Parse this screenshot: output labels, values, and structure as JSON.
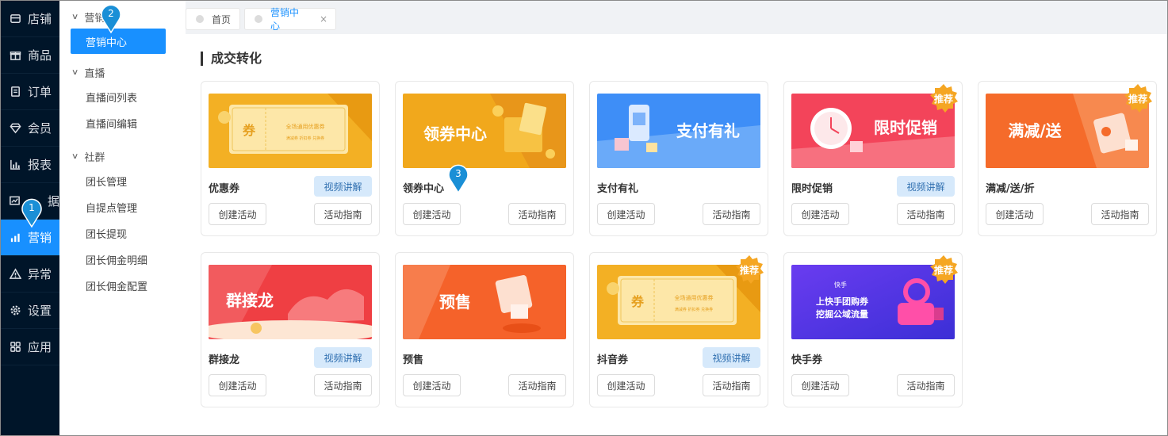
{
  "nav": {
    "items": [
      {
        "label": "店铺",
        "icon": "store-icon"
      },
      {
        "label": "商品",
        "icon": "gift-icon"
      },
      {
        "label": "订单",
        "icon": "order-icon"
      },
      {
        "label": "会员",
        "icon": "diamond-icon"
      },
      {
        "label": "报表",
        "icon": "bar-chart-icon"
      },
      {
        "label": "据",
        "icon": "data-icon"
      },
      {
        "label": "营销",
        "icon": "marketing-icon"
      },
      {
        "label": "异常",
        "icon": "warning-icon"
      },
      {
        "label": "设置",
        "icon": "gear-icon"
      },
      {
        "label": "应用",
        "icon": "apps-icon"
      }
    ]
  },
  "submenu": {
    "group_marketing": "营销",
    "item_marketing_center": "营销中心",
    "group_live": "直播",
    "live_items": [
      "直播间列表",
      "直播间编辑"
    ],
    "group_community": "社群",
    "community_items": [
      "团长管理",
      "自提点管理",
      "团长提现",
      "团长佣金明细",
      "团长佣金配置"
    ]
  },
  "tabs": [
    {
      "label": "首页"
    },
    {
      "label": "营销中心",
      "close": "×"
    }
  ],
  "section_title": "成交转化",
  "cards": [
    {
      "name": "优惠券",
      "video": "视频讲解",
      "create": "创建活动",
      "guide": "活动指南",
      "banner_text": "券",
      "banner_sub": "全场通用优惠券",
      "banner_sub2": "满减券 折扣券 兑换券"
    },
    {
      "name": "领券中心",
      "create": "创建活动",
      "guide": "活动指南",
      "banner_text": "领券中心"
    },
    {
      "name": "支付有礼",
      "create": "创建活动",
      "guide": "活动指南",
      "banner_text": "支付有礼"
    },
    {
      "name": "限时促销",
      "video": "视频讲解",
      "create": "创建活动",
      "guide": "活动指南",
      "badge": "推荐",
      "banner_text": "限时促销"
    },
    {
      "name": "满减/送/折",
      "create": "创建活动",
      "guide": "活动指南",
      "badge": "推荐",
      "banner_text": "满减/送"
    },
    {
      "name": "群接龙",
      "video": "视频讲解",
      "create": "创建活动",
      "guide": "活动指南",
      "banner_text": "群接龙"
    },
    {
      "name": "预售",
      "create": "创建活动",
      "guide": "活动指南",
      "banner_text": "预售"
    },
    {
      "name": "抖音券",
      "video": "视频讲解",
      "create": "创建活动",
      "guide": "活动指南",
      "badge": "推荐",
      "banner_text": "券",
      "banner_sub": "全场通用优惠券",
      "banner_sub2": "满减券 折扣券 兑换券"
    },
    {
      "name": "快手券",
      "create": "创建活动",
      "guide": "活动指南",
      "badge": "推荐",
      "banner_brand": "快手",
      "banner_line1": "上快手团购券",
      "banner_line2": "挖掘公域流量"
    }
  ],
  "markers": [
    "1",
    "2",
    "3"
  ],
  "colors": {
    "nav_bg": "#001529",
    "accent": "#1890ff",
    "badge": "#f5a623",
    "video_btn_bg": "#d6e9fb",
    "marker": "#1a8fd6"
  }
}
